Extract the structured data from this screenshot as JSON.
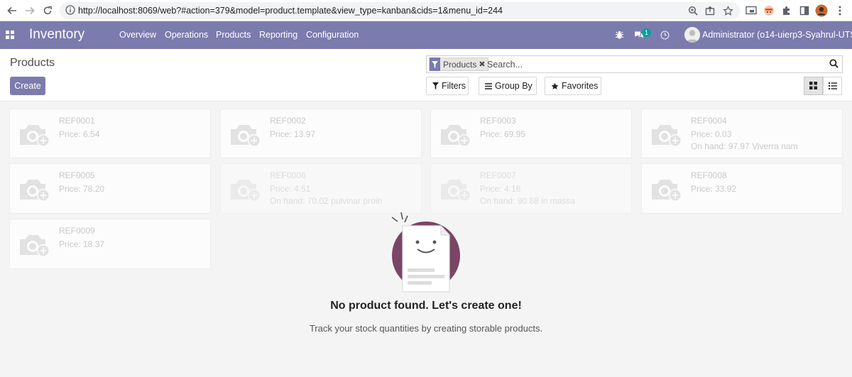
{
  "browser": {
    "url": "http://localhost:8069/web?#action=379&model=product.template&view_type=kanban&cids=1&menu_id=244",
    "back_icon": "arrow-left-icon",
    "forward_icon": "arrow-right-icon",
    "reload_icon": "reload-icon"
  },
  "navbar": {
    "brand": "Inventory",
    "menu": [
      "Overview",
      "Operations",
      "Products",
      "Reporting",
      "Configuration"
    ],
    "messages_count": "1",
    "user": "Administrator (o14-uierp3-Syahrul-UTS)",
    "color": "#7c7bad"
  },
  "control_panel": {
    "title": "Products",
    "create_label": "Create",
    "facet_label": "Products",
    "search_placeholder": "Search...",
    "filters_label": "Filters",
    "group_by_label": "Group By",
    "favorites_label": "Favorites",
    "active_view": "kanban"
  },
  "sample_cards": [
    {
      "ref": "REF0001",
      "price": "Price: 6.54",
      "extra": ""
    },
    {
      "ref": "REF0002",
      "price": "Price: 13.97",
      "extra": ""
    },
    {
      "ref": "REF0003",
      "price": "Price: 69.95",
      "extra": ""
    },
    {
      "ref": "REF0004",
      "price": "Price: 0.03",
      "extra": "On hand: 97.97 Viverra nam"
    },
    {
      "ref": "REF0005",
      "price": "Price: 78.20",
      "extra": ""
    },
    {
      "ref": "REF0006",
      "price": "Price: 4.51",
      "extra": "On hand: 70.02 pulvinar proin"
    },
    {
      "ref": "REF0007",
      "price": "Price: 4.16",
      "extra": "On hand: 90.68 in massa"
    },
    {
      "ref": "REF0008",
      "price": "Price: 33.92",
      "extra": ""
    },
    {
      "ref": "REF0009",
      "price": "Price: 18.37",
      "extra": ""
    }
  ],
  "no_content": {
    "title": "No product found. Let's create one!",
    "text": "Track your stock quantities by creating storable products."
  }
}
